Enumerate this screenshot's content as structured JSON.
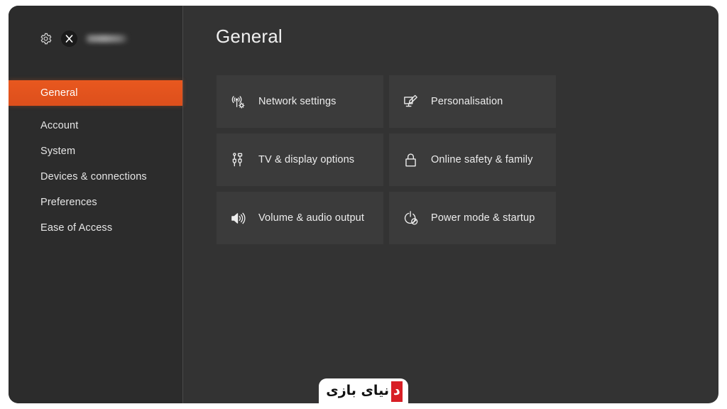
{
  "app": {
    "screen_title": "General",
    "background_color": "#ffffff",
    "panel_color": "#333333",
    "sidebar_color": "#2c2c2c",
    "tile_color": "#3b3b3b",
    "accent_color": "#e25822",
    "text_color": "#ededed"
  },
  "sidebar": {
    "header": {
      "gear_icon": "gear-icon",
      "avatar_icon": "xbox-avatar-icon",
      "gamertag": ""
    },
    "items": [
      {
        "label": "General",
        "selected": true
      },
      {
        "label": "Account",
        "selected": false
      },
      {
        "label": "System",
        "selected": false
      },
      {
        "label": "Devices & connections",
        "selected": false
      },
      {
        "label": "Preferences",
        "selected": false
      },
      {
        "label": "Ease of Access",
        "selected": false
      }
    ]
  },
  "main": {
    "title": "General",
    "tiles": [
      {
        "label": "Network settings",
        "icon": "network-antenna-gear-icon"
      },
      {
        "label": "Personalisation",
        "icon": "monitor-pencil-icon"
      },
      {
        "label": "TV & display options",
        "icon": "hdmi-connector-icon"
      },
      {
        "label": "Online safety & family",
        "icon": "padlock-icon"
      },
      {
        "label": "Volume & audio output",
        "icon": "speaker-waves-icon"
      },
      {
        "label": "Power mode & startup",
        "icon": "power-leaf-icon"
      }
    ]
  },
  "watermark": {
    "badge_text": "د",
    "text": "نیای بازی",
    "badge_color": "#d81f26",
    "text_color": "#111111",
    "background_color": "#ffffff"
  }
}
